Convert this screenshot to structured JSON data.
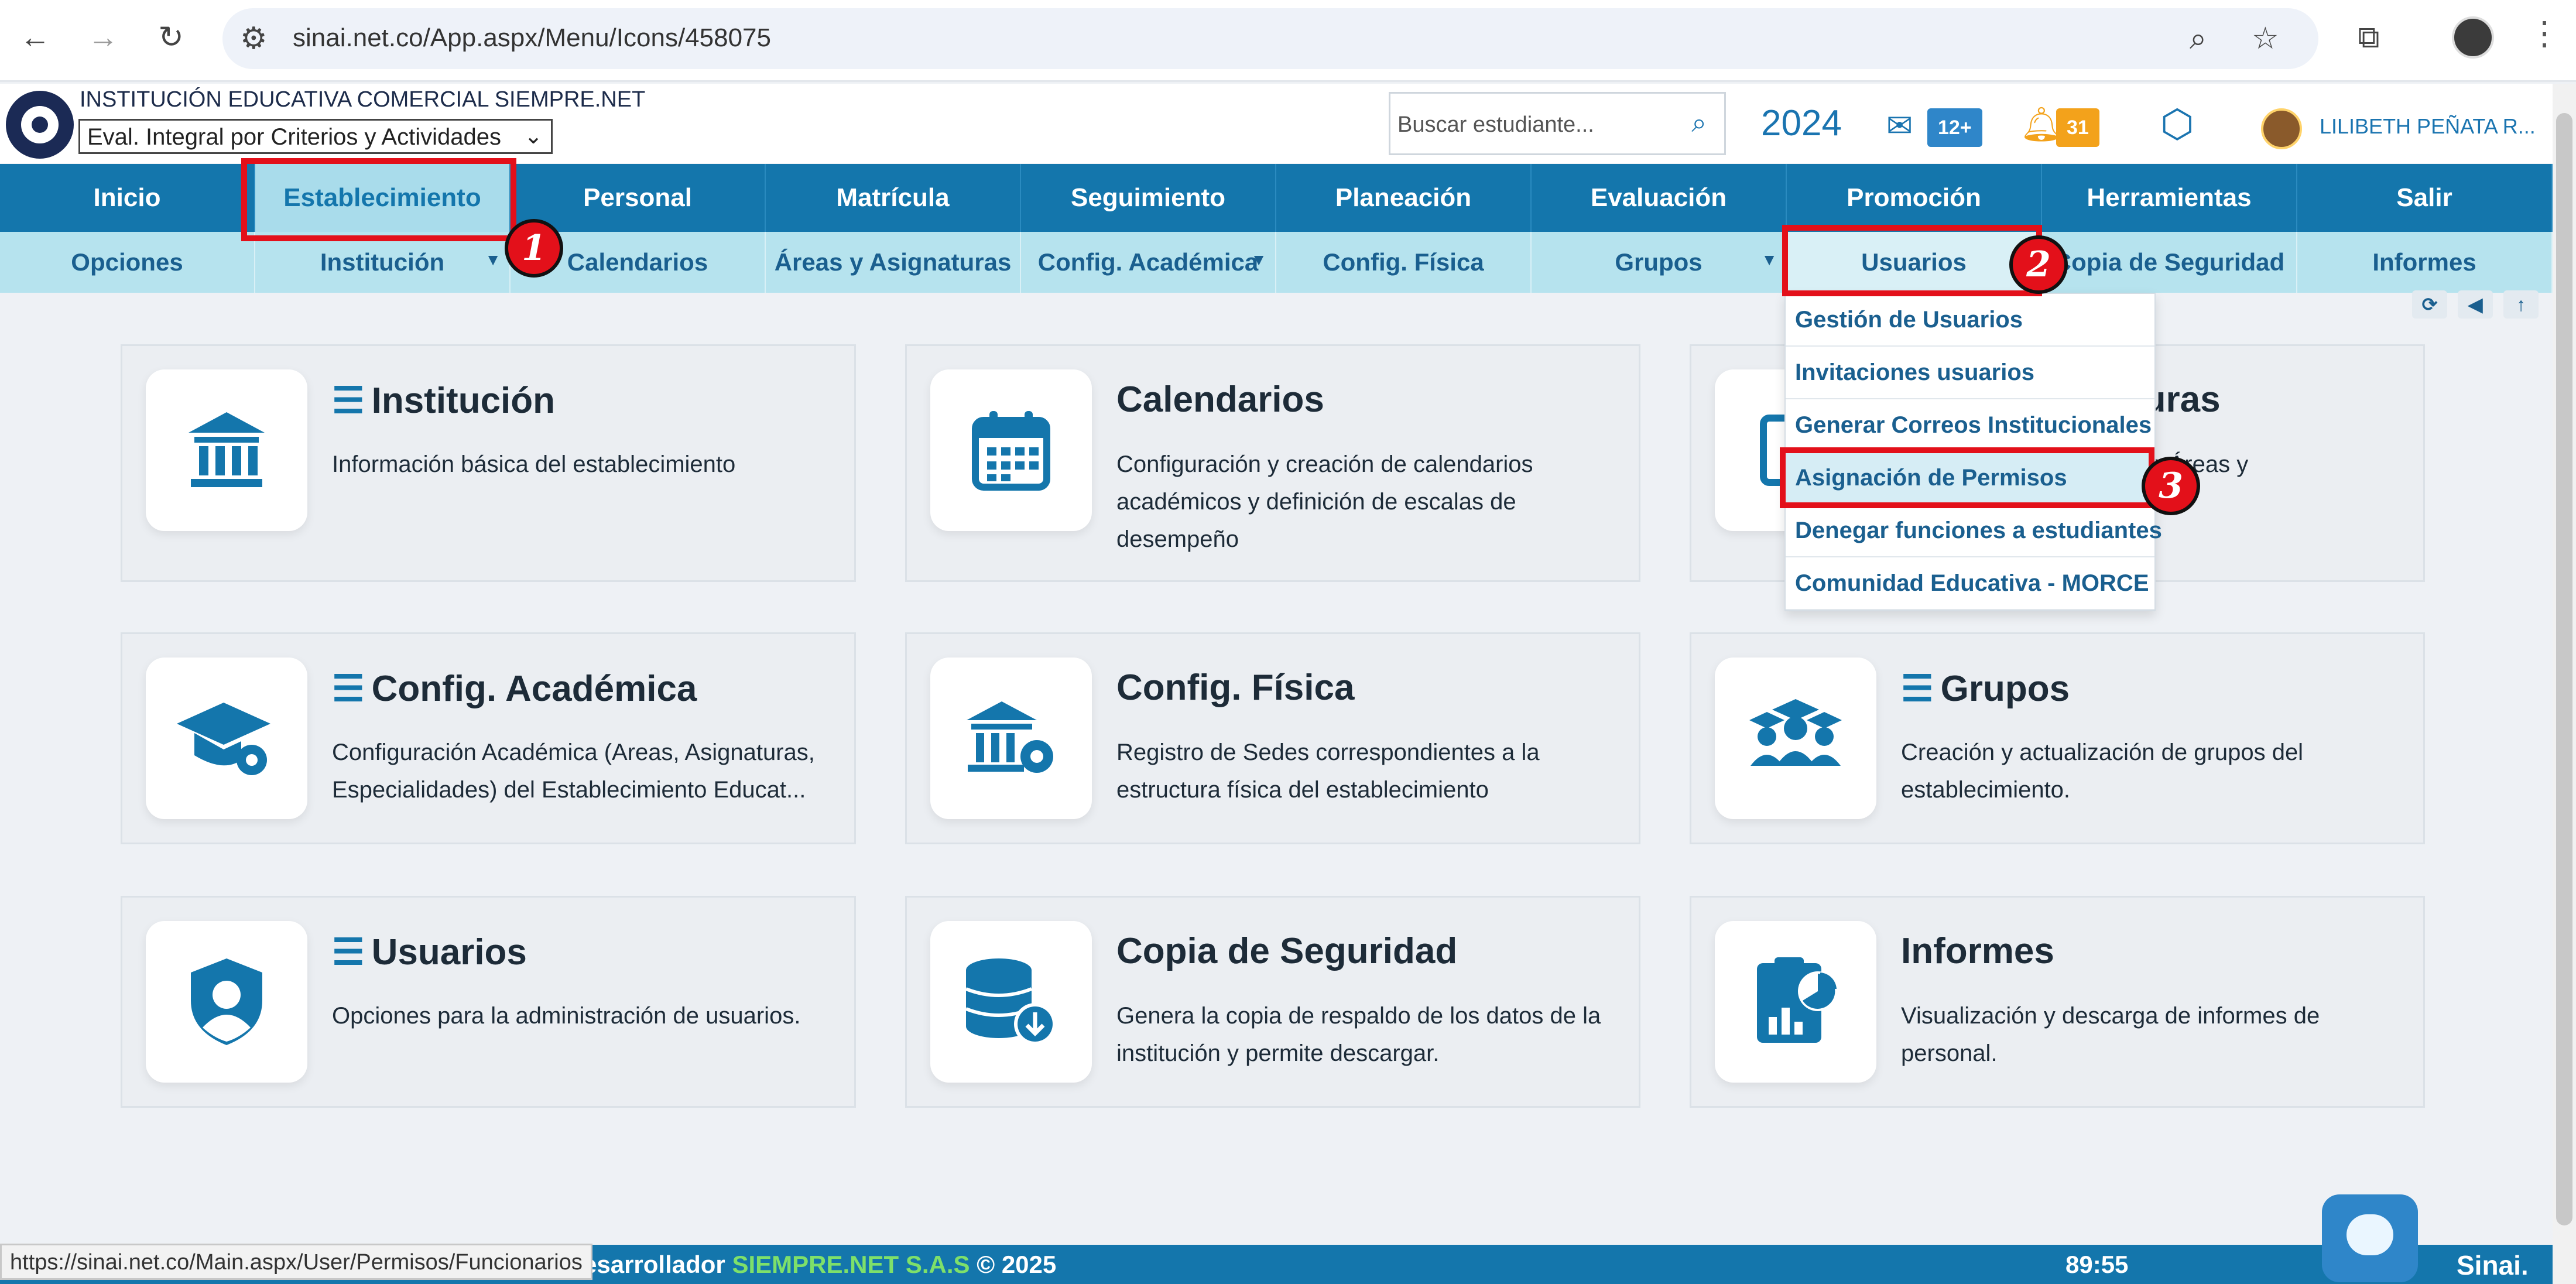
{
  "browser": {
    "url": "sinai.net.co/App.aspx/Menu/Icons/458075",
    "back_icon": "←",
    "forward_icon": "→",
    "reload_icon": "↻",
    "site_info_icon": "⚙",
    "zoom_icon": "⌕",
    "star_icon": "☆",
    "extensions_icon": "⧉",
    "menu_icon": "⋮"
  },
  "header": {
    "institution": "INSTITUCIÓN EDUCATIVA COMERCIAL SIEMPRE.NET",
    "eval_select": "Eval. Integral por Criterios y Actividades",
    "search_placeholder": "Buscar estudiante...",
    "year": "2024",
    "mail_badge": "12+",
    "bell_badge": "31",
    "user_name": "LILIBETH PEÑATA R..."
  },
  "main_nav": [
    "Inicio",
    "Establecimiento",
    "Personal",
    "Matrícula",
    "Seguimiento",
    "Planeación",
    "Evaluación",
    "Promoción",
    "Herramientas",
    "Salir"
  ],
  "sub_nav": [
    "Opciones",
    "Institución",
    "Calendarios",
    "Áreas y Asignaturas",
    "Config. Académica",
    "Config. Física",
    "Grupos",
    "Usuarios",
    "Copia de Seguridad",
    "Informes"
  ],
  "dropdown": [
    "Gestión de Usuarios",
    "Invitaciones usuarios",
    "Generar Correos Institucionales",
    "Asignación de Permisos",
    "Denegar funciones a estudiantes",
    "Comunidad Educativa - MORCE"
  ],
  "cards": [
    {
      "title": "Institución",
      "desc": "Información básica del establecimiento",
      "icon": "bank-icon"
    },
    {
      "title": "Calendarios",
      "desc": "Configuración y creación de calendarios académicos y definición de escalas de desempeño",
      "icon": "calendar-icon"
    },
    {
      "title": "turas",
      "desc": "de Áreas y",
      "icon": "book-icon"
    },
    {
      "title": "Config. Académica",
      "desc": "Configuración Académica (Areas, Asignaturas, Especialidades) del Establecimiento Educat...",
      "icon": "graduation-gear-icon"
    },
    {
      "title": "Config. Física",
      "desc": "Registro de Sedes correspondientes a la estructura física del establecimiento",
      "icon": "building-gear-icon"
    },
    {
      "title": "Grupos",
      "desc": "Creación y actualización de grupos del establecimiento.",
      "icon": "group-icon"
    },
    {
      "title": "Usuarios",
      "desc": "Opciones para la administración de usuarios.",
      "icon": "user-shield-icon"
    },
    {
      "title": "Copia de Seguridad",
      "desc": "Genera la copia de respaldo de los datos de la institución y permite descargar.",
      "icon": "database-download-icon"
    },
    {
      "title": "Informes",
      "desc": "Visualización y descarga de informes de personal.",
      "icon": "report-icon"
    }
  ],
  "steps": [
    "1",
    "2",
    "3"
  ],
  "status": {
    "hover_url": "https://sinai.net.co/Main.aspx/User/Permisos/Funcionarios",
    "footer_prefix": "esarrollador",
    "footer_brand": "SIEMPRE.NET S.A.S",
    "footer_copy": "© 2025",
    "timer": "89:55",
    "footer_logo": "Sinai."
  },
  "colors": {
    "nav": "#1476ac",
    "subnav": "#b6e3ee",
    "highlight": "#e3101a",
    "badge_mail": "#2f86c9",
    "badge_bell": "#f3a21b"
  }
}
